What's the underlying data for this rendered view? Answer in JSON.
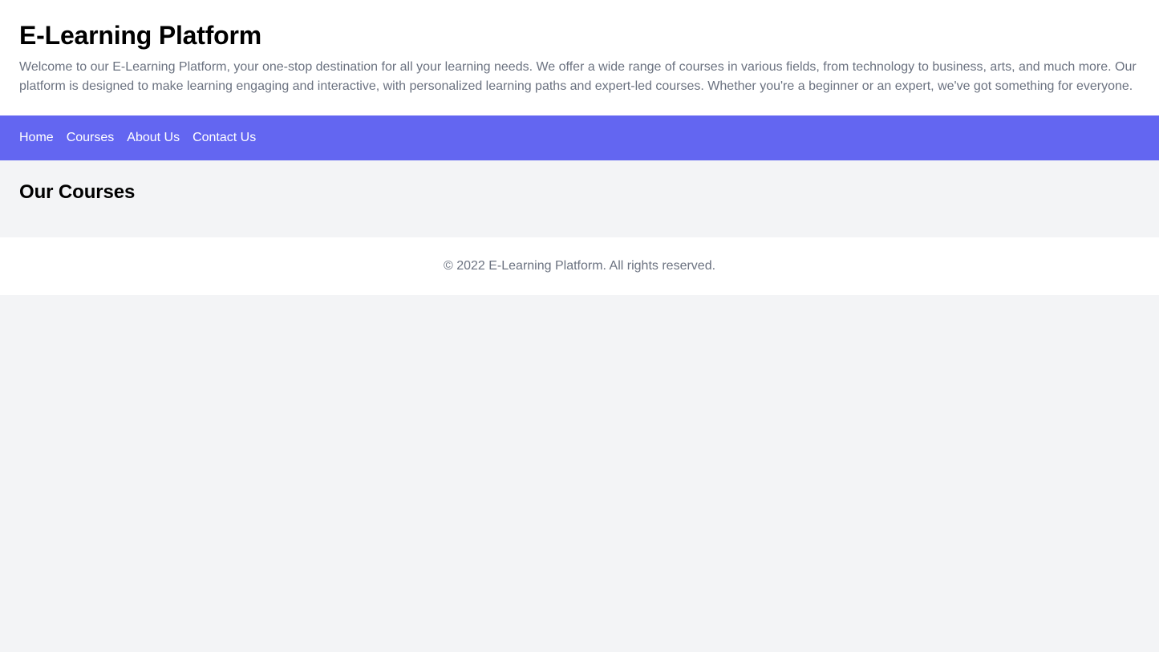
{
  "header": {
    "title": "E-Learning Platform",
    "intro": "Welcome to our E-Learning Platform, your one-stop destination for all your learning needs. We offer a wide range of courses in various fields, from technology to business, arts, and much more. Our platform is designed to make learning engaging and interactive, with personalized learning paths and expert-led courses. Whether you're a beginner or an expert, we've got something for everyone."
  },
  "nav": {
    "background_color": "#6366f1",
    "items": [
      {
        "label": "Home"
      },
      {
        "label": "Courses"
      },
      {
        "label": "About Us"
      },
      {
        "label": "Contact Us"
      }
    ]
  },
  "main": {
    "section_title": "Our Courses",
    "courses": []
  },
  "footer": {
    "copyright": "© 2022 E-Learning Platform. All rights reserved."
  },
  "theme": {
    "page_background": "#f3f4f6",
    "surface": "#ffffff",
    "accent": "#6366f1",
    "heading_color": "#000000",
    "muted_text": "#6b7280"
  }
}
